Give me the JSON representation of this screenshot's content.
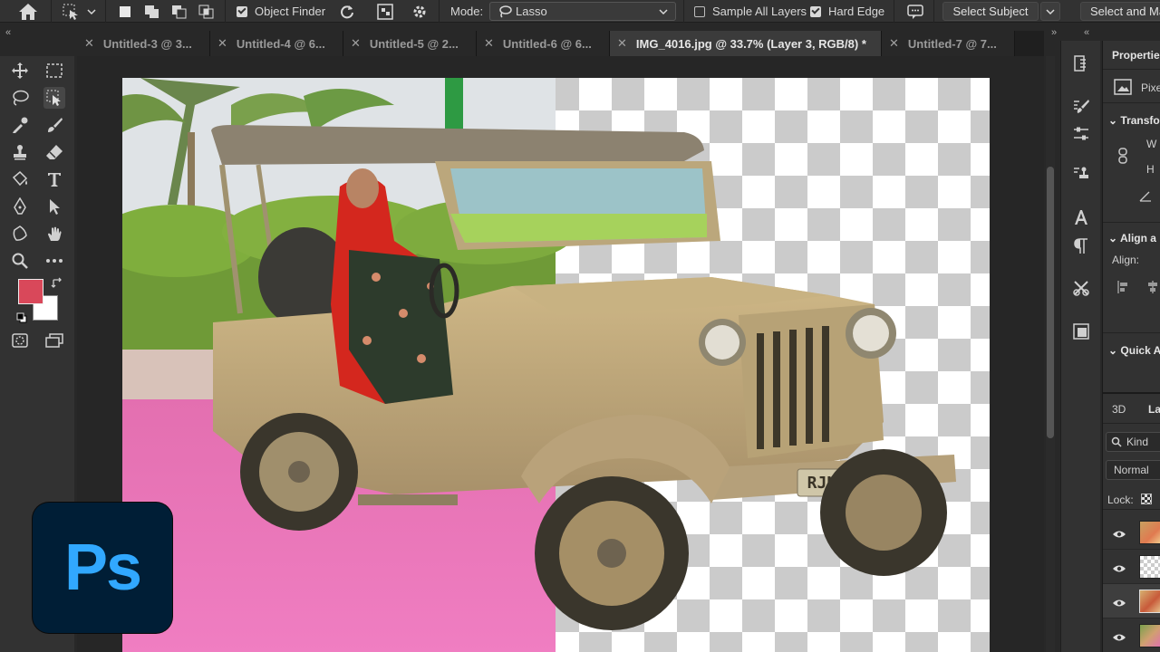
{
  "options_bar": {
    "object_finder_label": "Object Finder",
    "object_finder_checked": true,
    "mode_label": "Mode:",
    "mode_value": "Lasso",
    "sample_all_layers_label": "Sample All Layers",
    "sample_all_layers_checked": false,
    "hard_edge_label": "Hard Edge",
    "hard_edge_checked": true,
    "select_subject_label": "Select Subject",
    "select_and_mask_label": "Select and Ma"
  },
  "tabs": [
    {
      "label": "Untitled-3 @ 3...",
      "active": false
    },
    {
      "label": "Untitled-4 @ 6...",
      "active": false
    },
    {
      "label": "Untitled-5 @ 2...",
      "active": false
    },
    {
      "label": "Untitled-6 @ 6...",
      "active": false
    },
    {
      "label": "IMG_4016.jpg @ 33.7% (Layer 3, RGB/8) *",
      "active": true
    },
    {
      "label": "Untitled-7 @ 7...",
      "active": false
    }
  ],
  "canvas": {
    "plate_text": "RJN 4190"
  },
  "colors": {
    "foreground": "#d9485a",
    "background": "#ffffff",
    "ps_blue": "#31a8ff",
    "ps_bg": "#001e36"
  },
  "properties_panel": {
    "title": "Propertie",
    "pixel_label": "Pixe",
    "transform_label": "Transfo",
    "w_label": "W",
    "h_label": "H",
    "align_label": "Align a",
    "align_sub": "Align:",
    "quick_label": "Quick A"
  },
  "layers_panel": {
    "tab_3d": "3D",
    "tab_layers": "La",
    "kind_label": "Kind",
    "blend_mode": "Normal",
    "lock_label": "Lock:"
  },
  "logo": {
    "text": "Ps"
  }
}
